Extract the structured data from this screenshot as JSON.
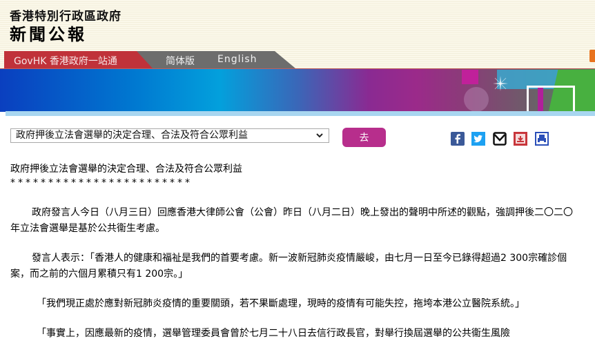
{
  "header": {
    "org_name": "香港特別行政區政府",
    "brand": "新聞公報"
  },
  "nav": {
    "govhk": "GovHK 香港政府一站通",
    "simplified": "简体版",
    "english": "English"
  },
  "toolbar": {
    "select_value": "政府押後立法會選舉的決定合理、合法及符合公眾利益",
    "go_label": "去",
    "share_icons": [
      "facebook-icon",
      "twitter-icon",
      "email-icon",
      "bookmark-icon",
      "print-icon"
    ]
  },
  "article": {
    "title": "政府押後立法會選舉的決定合理、合法及符合公眾利益",
    "separator": "************************",
    "paragraphs": [
      "政府發言人今日（八月三日）回應香港大律師公會（公會）昨日（八月二日）晚上發出的聲明中所述的觀點，強調押後二〇二〇年立法會選舉是基於公共衞生考慮。",
      "發言人表示：「香港人的健康和福祉是我們的首要考慮。新一波新冠肺炎疫情嚴峻，由七月一日至今已錄得超過2 300宗確診個案，而之前的六個月累積只有1 200宗。」",
      "「我們現正處於應對新冠肺炎疫情的重要關頭，若不果斷處理，現時的疫情有可能失控，拖垮本港公立醫院系統。」",
      "「事實上，因應最新的疫情，選舉管理委員會曾於七月二十八日去信行政長官，對舉行換屆選舉的公共衞生風險"
    ]
  },
  "colors": {
    "go_button": "#b72e8c",
    "govhk_tab": "#c0323a",
    "nav_grey": "#6d6d6d"
  }
}
